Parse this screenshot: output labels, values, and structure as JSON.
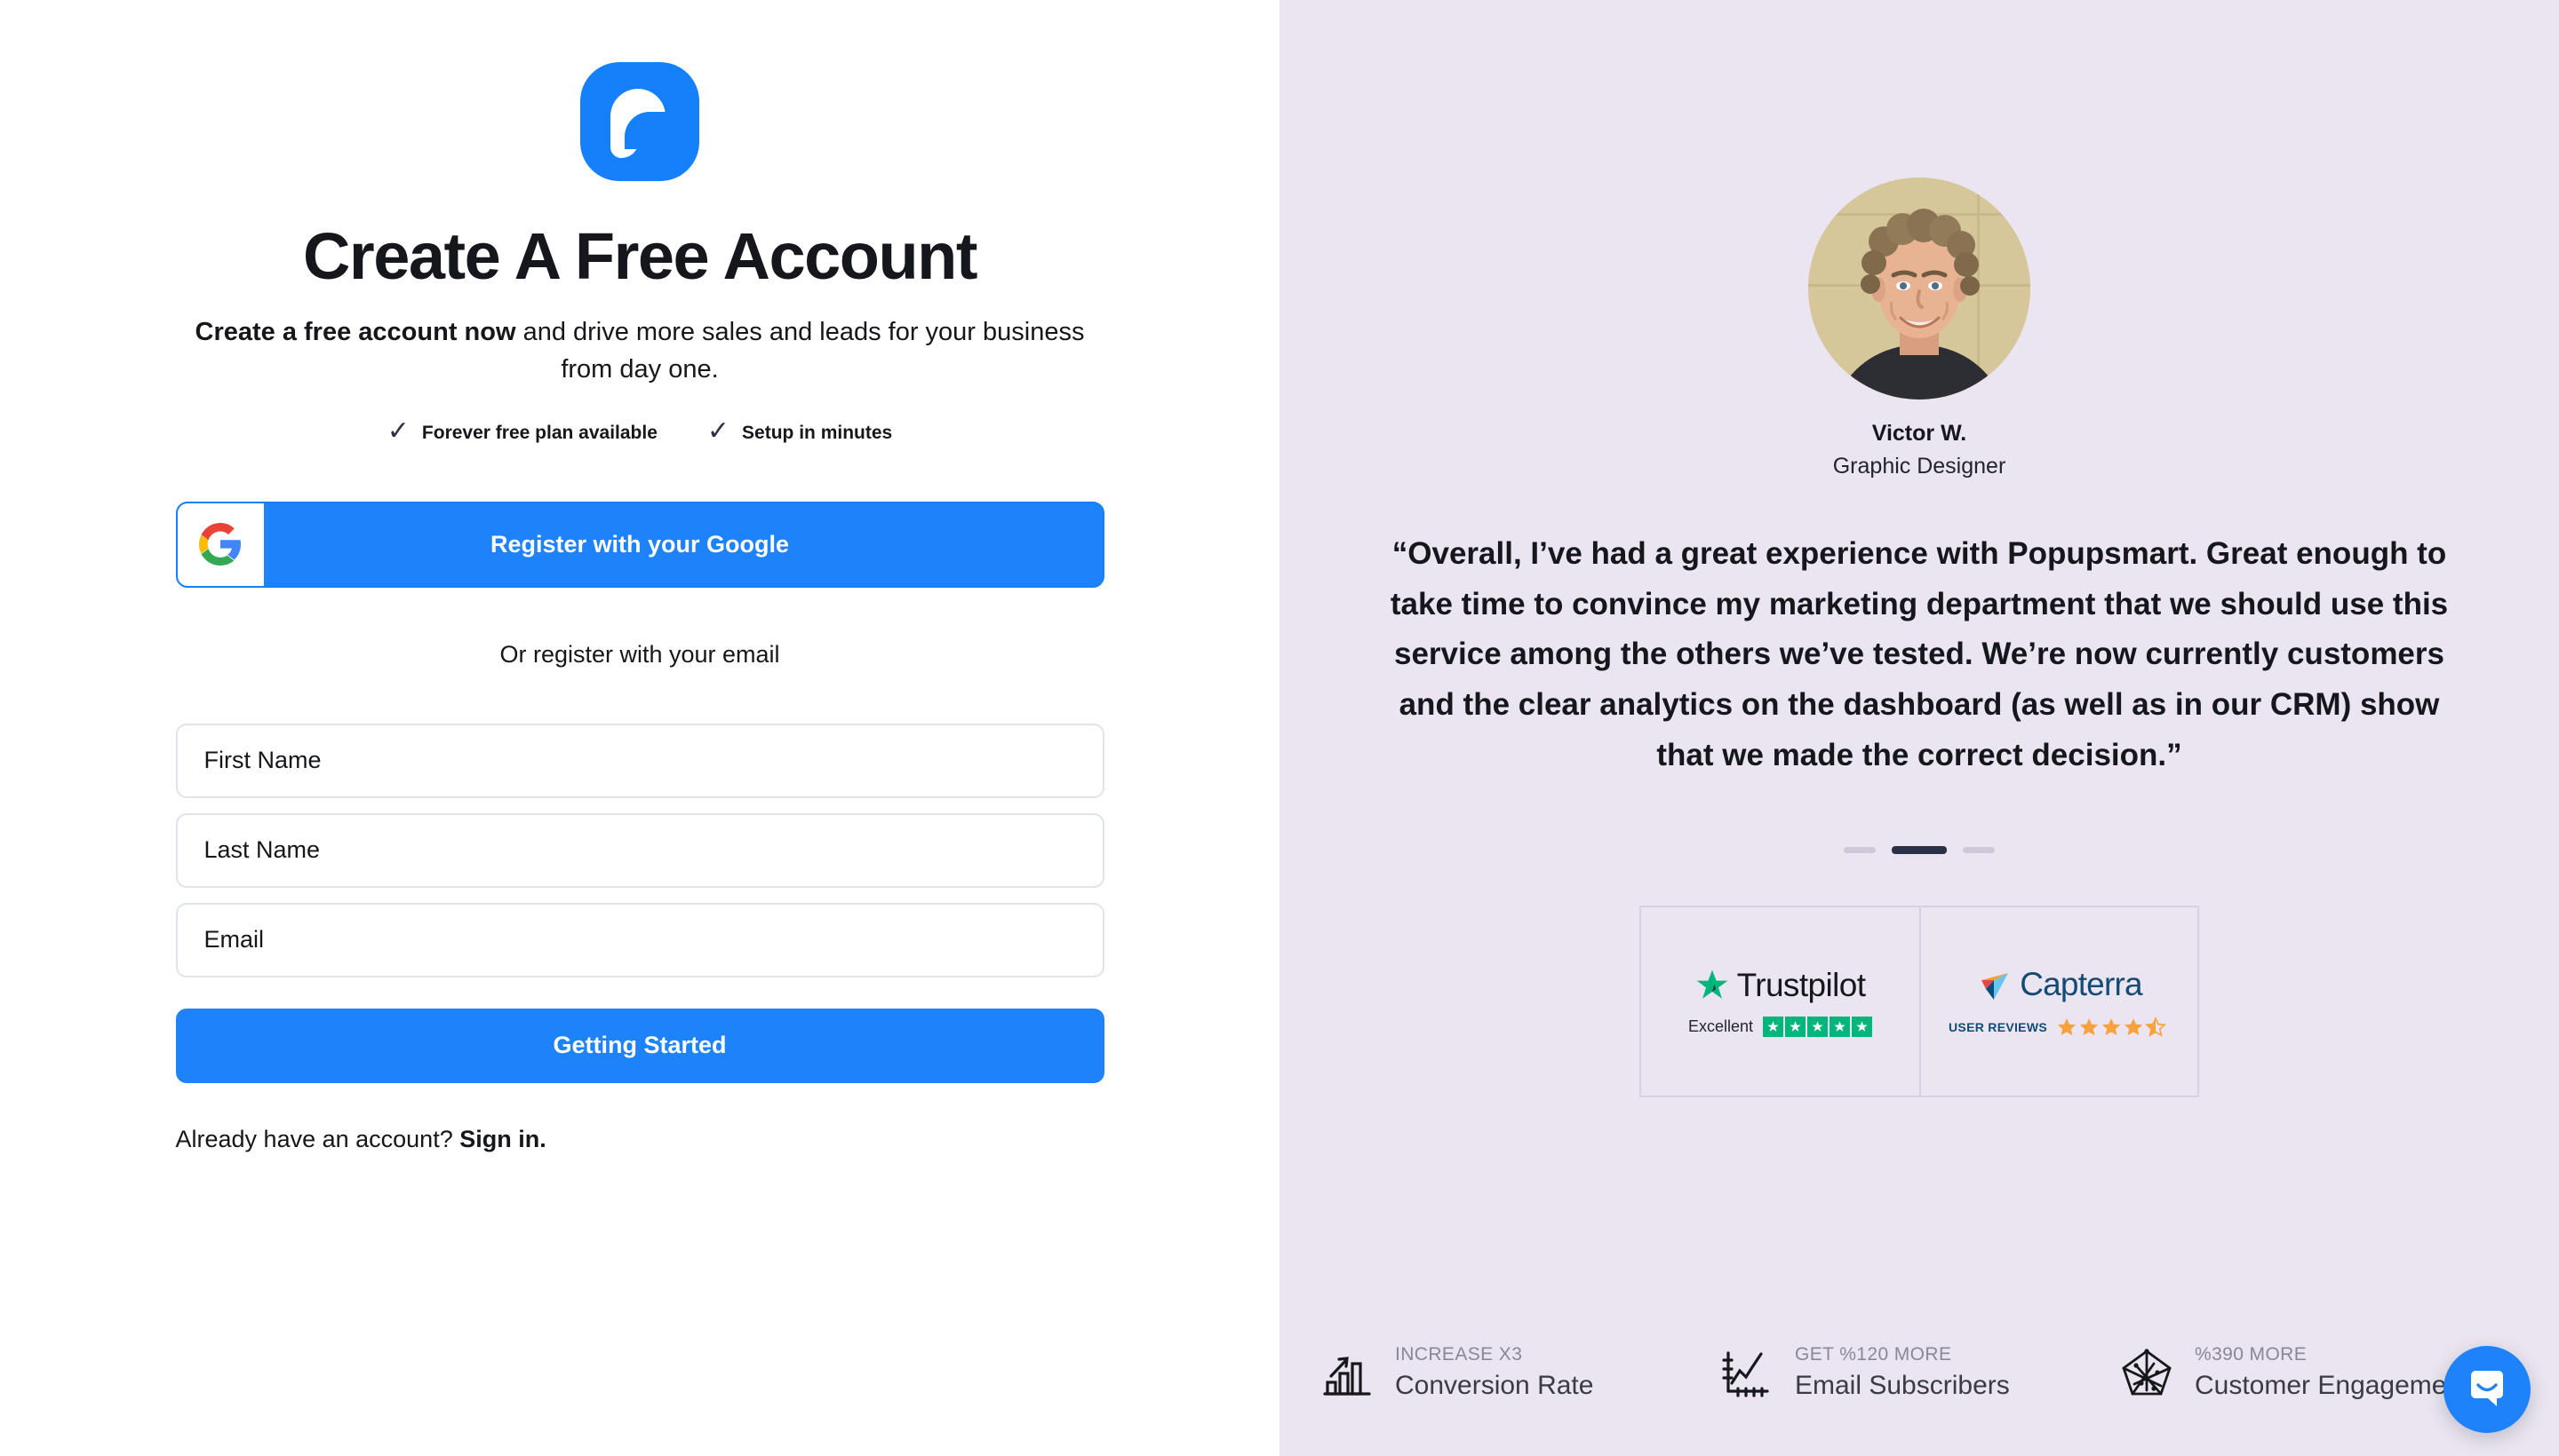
{
  "brand": {
    "logo_icon": "popupsmart-logo-icon",
    "accent_blue": "#1E83FB",
    "right_panel_bg": "#EAE5F0"
  },
  "signup": {
    "title": "Create A Free Account",
    "subtitle_bold": "Create a free account now",
    "subtitle_rest": " and drive more sales and leads for your business from day one.",
    "perks": [
      {
        "icon": "check-icon",
        "label": "Forever free plan available"
      },
      {
        "icon": "check-icon",
        "label": "Setup in minutes"
      }
    ],
    "google_button": {
      "icon": "google-g-icon",
      "label": "Register with your Google"
    },
    "divider_text": "Or register with your email",
    "fields": [
      {
        "name": "first-name",
        "placeholder": "First Name",
        "value": ""
      },
      {
        "name": "last-name",
        "placeholder": "Last Name",
        "value": ""
      },
      {
        "name": "email",
        "placeholder": "Email",
        "value": ""
      }
    ],
    "submit_label": "Getting Started",
    "signin_prompt": "Already have an account? ",
    "signin_link": "Sign in."
  },
  "testimonial": {
    "avatar_icon": "reviewer-avatar",
    "name": "Victor W.",
    "role": "Graphic Designer",
    "quote": "“Overall, I’ve had a great experience with Popupsmart. Great enough to take time to convince my marketing department that we should use this service among the others we’ve tested. We’re now currently customers and the clear analytics on the dashboard (as well as in our CRM) show that we made the correct decision.”",
    "carousel": {
      "total": 3,
      "active_index": 1
    }
  },
  "review_badges": [
    {
      "name": "trustpilot",
      "logo_icon": "trustpilot-star-icon",
      "wordmark": "Trustpilot",
      "rating_label": "Excellent",
      "stars": 5,
      "star_color": "#00B67A"
    },
    {
      "name": "capterra",
      "logo_icon": "capterra-plane-icon",
      "wordmark": "Capterra",
      "rating_label": "USER REVIEWS",
      "stars": 4.5,
      "star_color": "#F9A13A"
    }
  ],
  "stats": [
    {
      "icon": "bar-chart-up-icon",
      "kicker": "INCREASE X3",
      "label": "Conversion Rate"
    },
    {
      "icon": "line-chart-icon",
      "kicker": "GET %120 MORE",
      "label": "Email Subscribers"
    },
    {
      "icon": "radar-chart-icon",
      "kicker": "%390 MORE",
      "label": "Customer Engagement"
    }
  ],
  "chat_widget": {
    "icon": "chat-bubble-icon",
    "color": "#1E83FB"
  }
}
